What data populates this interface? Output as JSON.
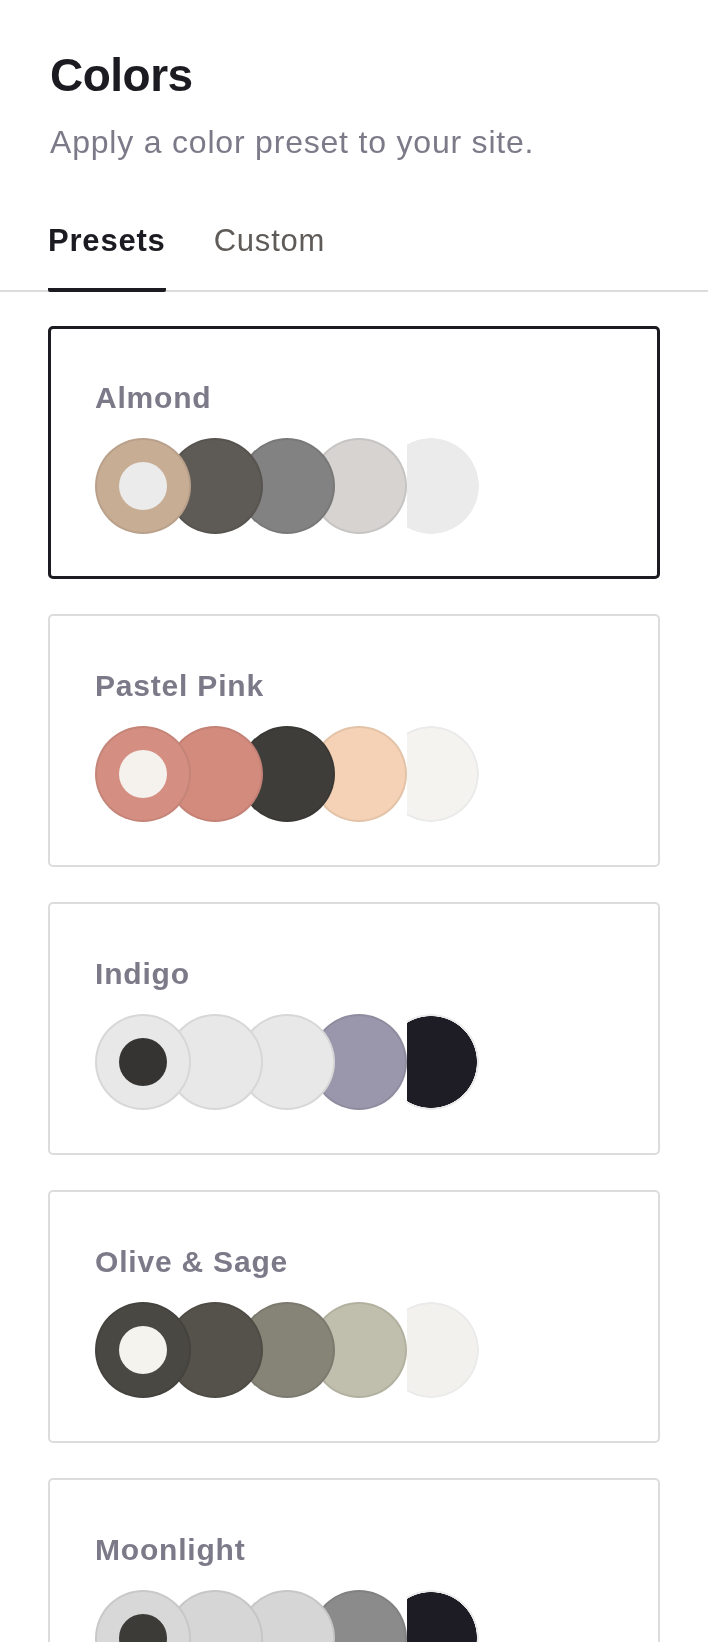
{
  "header": {
    "title": "Colors",
    "subtitle": "Apply a color preset to your site."
  },
  "tabs": [
    {
      "label": "Presets",
      "selected": true
    },
    {
      "label": "Custom",
      "selected": false
    }
  ],
  "presets": [
    {
      "name": "Almond",
      "selected": true,
      "swatches": [
        {
          "color": "#c8ad95",
          "dot": {
            "color": "#ebebeb"
          }
        },
        {
          "color": "#5e5a55"
        },
        {
          "color": "#838282"
        },
        {
          "color": "#d6d3d1"
        },
        {
          "color": "#ebebeb"
        }
      ]
    },
    {
      "name": "Pastel Pink",
      "selected": false,
      "swatches": [
        {
          "color": "#d48f82",
          "dot": {
            "color": "#f5f1ec"
          }
        },
        {
          "color": "#d38b7e"
        },
        {
          "color": "#3e3d3a"
        },
        {
          "color": "#f5d2b5"
        },
        {
          "color": "#f5f3ef"
        }
      ]
    },
    {
      "name": "Indigo",
      "selected": false,
      "swatches": [
        {
          "color": "#e8e8e8",
          "dot": {
            "color": "#353433"
          }
        },
        {
          "color": "#e8e8e8"
        },
        {
          "color": "#e8e8e8"
        },
        {
          "color": "#9a97ac"
        },
        {
          "color": "#1e1d25"
        }
      ]
    },
    {
      "name": "Olive & Sage",
      "selected": false,
      "swatches": [
        {
          "color": "#4a4843",
          "dot": {
            "color": "#f5f3ee"
          }
        },
        {
          "color": "#55524b"
        },
        {
          "color": "#868477"
        },
        {
          "color": "#c0bfad"
        },
        {
          "color": "#f3f1ee"
        }
      ]
    },
    {
      "name": "Moonlight",
      "selected": false,
      "swatches": [
        {
          "color": "#d8d8d8",
          "dot": {
            "color": "#3c3b38"
          }
        },
        {
          "color": "#d6d6d6"
        },
        {
          "color": "#d6d6d6"
        },
        {
          "color": "#8c8b8b"
        },
        {
          "color": "#1d1c24"
        }
      ]
    }
  ]
}
